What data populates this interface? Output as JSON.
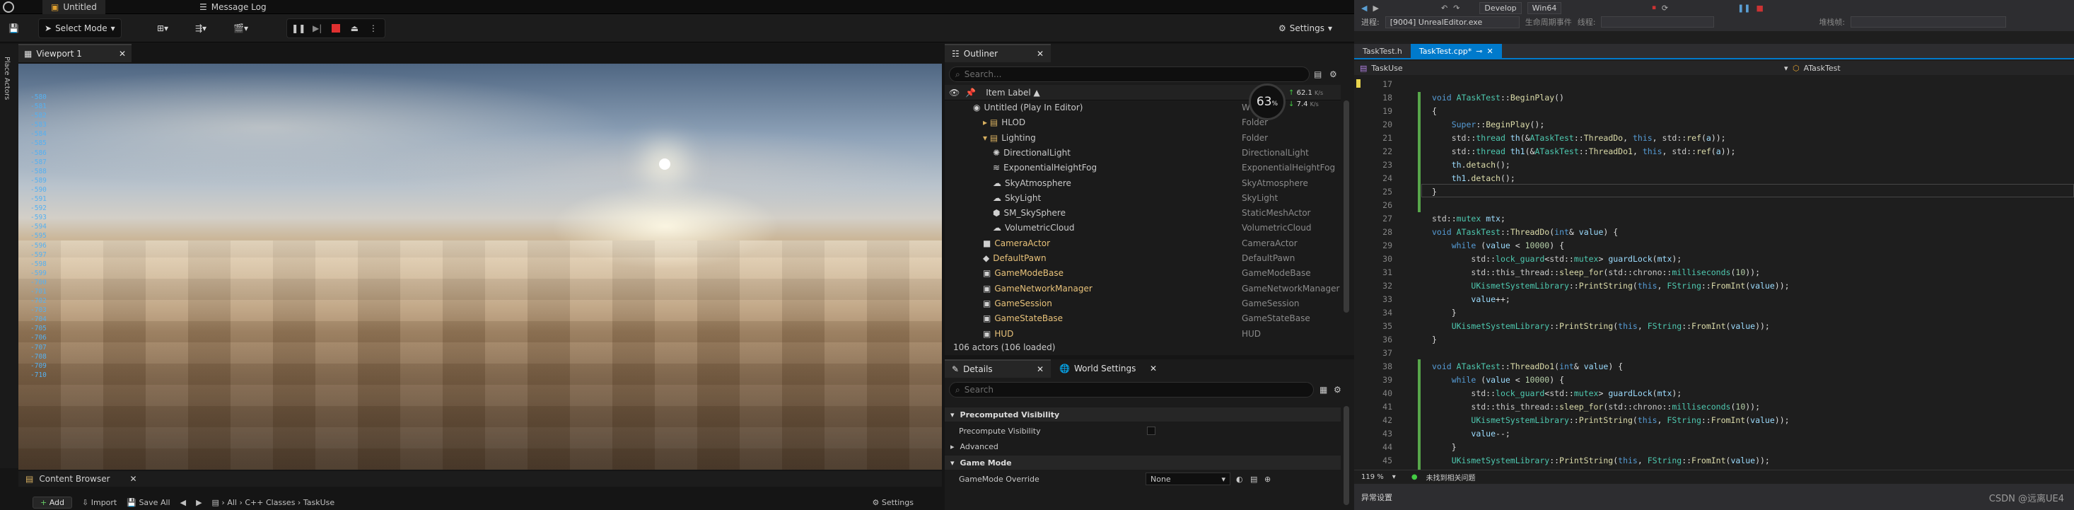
{
  "ue": {
    "doc_tabs": [
      "Untitled",
      "Message Log"
    ],
    "toolbar": {
      "select_mode": "Select Mode",
      "settings": "Settings"
    },
    "side_strip_label": "Place Actors",
    "viewport_tab": "Viewport 1",
    "viewport_log": [
      "-580",
      "-581",
      "-582",
      "-583",
      "-584",
      "-585",
      "-586",
      "-587",
      "-588",
      "-589",
      "-590",
      "-591",
      "-592",
      "-593",
      "-594",
      "-595",
      "-596",
      "-597",
      "-598",
      "-599",
      "-700",
      "-701",
      "-702",
      "-703",
      "-704",
      "-705",
      "-706",
      "-707",
      "-708",
      "-709",
      "-710"
    ],
    "content_browser": {
      "tab": "Content Browser",
      "add": "Add",
      "import": "Import",
      "save_all": "Save All",
      "path": [
        "All",
        "C++ Classes",
        "TaskUse"
      ],
      "settings": "Settings"
    },
    "outliner": {
      "tab": "Outliner",
      "search_placeholder": "Search...",
      "col_label": "Item Label ▲",
      "col_type": "Type",
      "rows": [
        {
          "name": "Untitled (Play In Editor)",
          "type": "World",
          "indent": 0,
          "kind": "world"
        },
        {
          "name": "HLOD",
          "type": "Folder",
          "indent": 1,
          "kind": "folder"
        },
        {
          "name": "Lighting",
          "type": "Folder",
          "indent": 1,
          "kind": "folder-open"
        },
        {
          "name": "DirectionalLight",
          "type": "DirectionalLight",
          "indent": 2,
          "kind": "light"
        },
        {
          "name": "ExponentialHeightFog",
          "type": "ExponentialHeightFog",
          "indent": 2,
          "kind": "fog"
        },
        {
          "name": "SkyAtmosphere",
          "type": "SkyAtmosphere",
          "indent": 2,
          "kind": "sky"
        },
        {
          "name": "SkyLight",
          "type": "SkyLight",
          "indent": 2,
          "kind": "sky"
        },
        {
          "name": "SM_SkySphere",
          "type": "StaticMeshActor",
          "indent": 2,
          "kind": "mesh"
        },
        {
          "name": "VolumetricCloud",
          "type": "VolumetricCloud",
          "indent": 2,
          "kind": "cloud"
        },
        {
          "name": "CameraActor",
          "type": "CameraActor",
          "indent": 1,
          "kind": "camera"
        },
        {
          "name": "DefaultPawn",
          "type": "DefaultPawn",
          "indent": 1,
          "kind": "pawn"
        },
        {
          "name": "GameModeBase",
          "type": "GameModeBase",
          "indent": 1,
          "kind": "actor"
        },
        {
          "name": "GameNetworkManager",
          "type": "GameNetworkManager",
          "indent": 1,
          "kind": "actor"
        },
        {
          "name": "GameSession",
          "type": "GameSession",
          "indent": 1,
          "kind": "actor"
        },
        {
          "name": "GameStateBase",
          "type": "GameStateBase",
          "indent": 1,
          "kind": "actor"
        },
        {
          "name": "HUD",
          "type": "HUD",
          "indent": 1,
          "kind": "actor"
        }
      ],
      "footer": "106 actors (106 loaded)",
      "stat_pct": "63",
      "stat_up": "62.1",
      "stat_down": "7.4",
      "stat_unit": "K/s"
    },
    "details": {
      "tab": "Details",
      "tab2": "World Settings",
      "search_placeholder": "Search",
      "sections": {
        "precomputed": "Precomputed Visibility",
        "precomputed_prop": "Precompute Visibility",
        "advanced": "Advanced",
        "gamemode": "Game Mode",
        "gamemode_prop": "GameMode Override",
        "gamemode_value": "None"
      }
    }
  },
  "vs": {
    "toolbar_menu": "Develop",
    "platform": "Win64",
    "process_label": "进程:",
    "process_value": "[9004] UnrealEditor.exe",
    "lifecycle": "生命周期事件",
    "thread": "线程:",
    "stackframe": "堆栈帧:",
    "file_tabs": [
      "TaskTest.h",
      "TaskTest.cpp*"
    ],
    "nav_left": "TaskUse",
    "nav_right": "ATaskTest",
    "zoom": "119 %",
    "status_msg": "未找到相关问题",
    "bottom_panel": "异常设置",
    "watermark": "CSDN @远离UE4"
  }
}
